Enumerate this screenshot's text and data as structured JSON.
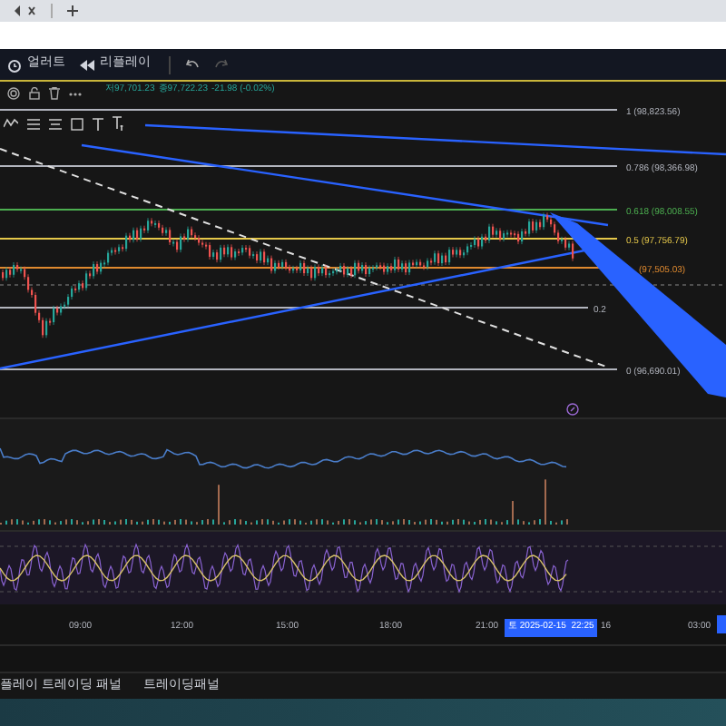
{
  "toolbar": {
    "buttons": [
      {
        "label": "얼러트",
        "kind": "alert"
      },
      {
        "label": "리플레이",
        "kind": "replay"
      }
    ]
  },
  "legend": {
    "low": "저97,701.23",
    "close": "종97,722.23",
    "change": "-21.98 (-0.02%)"
  },
  "fib_levels": [
    {
      "label": "1 (98,823.56)",
      "color": "#b2b5be"
    },
    {
      "label": "0.786 (98,366.98)",
      "color": "#b2b5be"
    },
    {
      "label": "0.618 (98,008.55)",
      "color": "#4caf50"
    },
    {
      "label": "0.5 (97,756.79)",
      "color": "#e6c84a"
    },
    {
      "label": "(97,505.03)",
      "color": "#e08a2f"
    },
    {
      "label": "0.2",
      "color": "#b2b5be"
    },
    {
      "label": "0 (96,690.01)",
      "color": "#b2b5be"
    }
  ],
  "time_axis": {
    "ticks": [
      "09:00",
      "12:00",
      "15:00",
      "18:00",
      "21:00"
    ],
    "cursor_label": "토 2025-02-15  22:25",
    "after": [
      "16",
      "03:00"
    ]
  },
  "bottom_tabs": [
    {
      "label": "플레이 트레이딩 패널"
    },
    {
      "label": "트레이딩패널"
    }
  ]
}
